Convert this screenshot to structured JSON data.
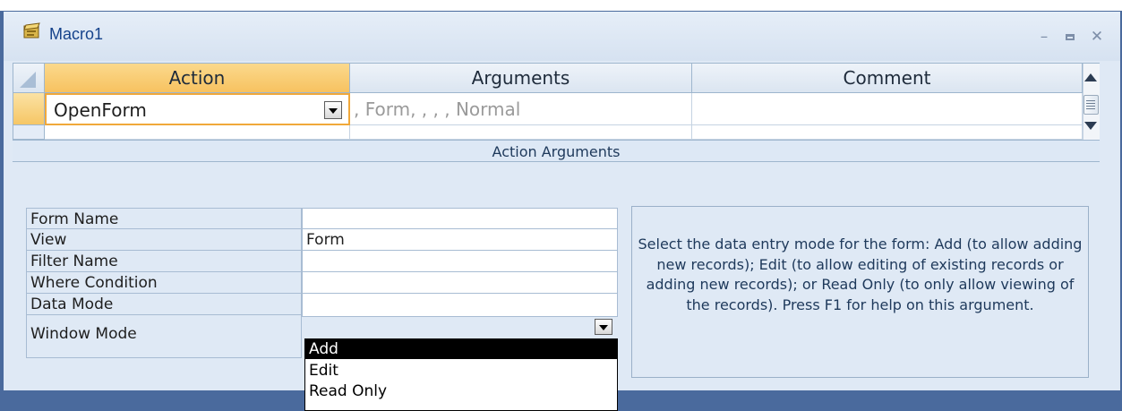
{
  "window": {
    "title": "Macro1"
  },
  "grid": {
    "headers": [
      "Action",
      "Arguments",
      "Comment"
    ],
    "rows": [
      {
        "action": "OpenForm",
        "arguments": ", Form, , , , Normal",
        "comment": ""
      },
      {
        "action": "",
        "arguments": "",
        "comment": ""
      }
    ]
  },
  "args_section_title": "Action Arguments",
  "properties": [
    {
      "label": "Form Name",
      "value": ""
    },
    {
      "label": "View",
      "value": "Form"
    },
    {
      "label": "Filter Name",
      "value": ""
    },
    {
      "label": "Where Condition",
      "value": ""
    },
    {
      "label": "Data Mode",
      "value": ""
    },
    {
      "label": "Window Mode",
      "value": ""
    }
  ],
  "dropdown": {
    "options": [
      "Add",
      "Edit",
      "Read Only"
    ],
    "highlighted": "Add"
  },
  "help_text": "Select the data entry mode for the form: Add (to allow adding new records); Edit (to allow editing of existing records or adding new records); or Read Only (to only allow viewing of the records). Press F1 for help on this argument.",
  "colors": {
    "title_text": "#15428b",
    "frame": "#4a6a9d",
    "active_header": "#f7c260",
    "selection": "#000000"
  }
}
